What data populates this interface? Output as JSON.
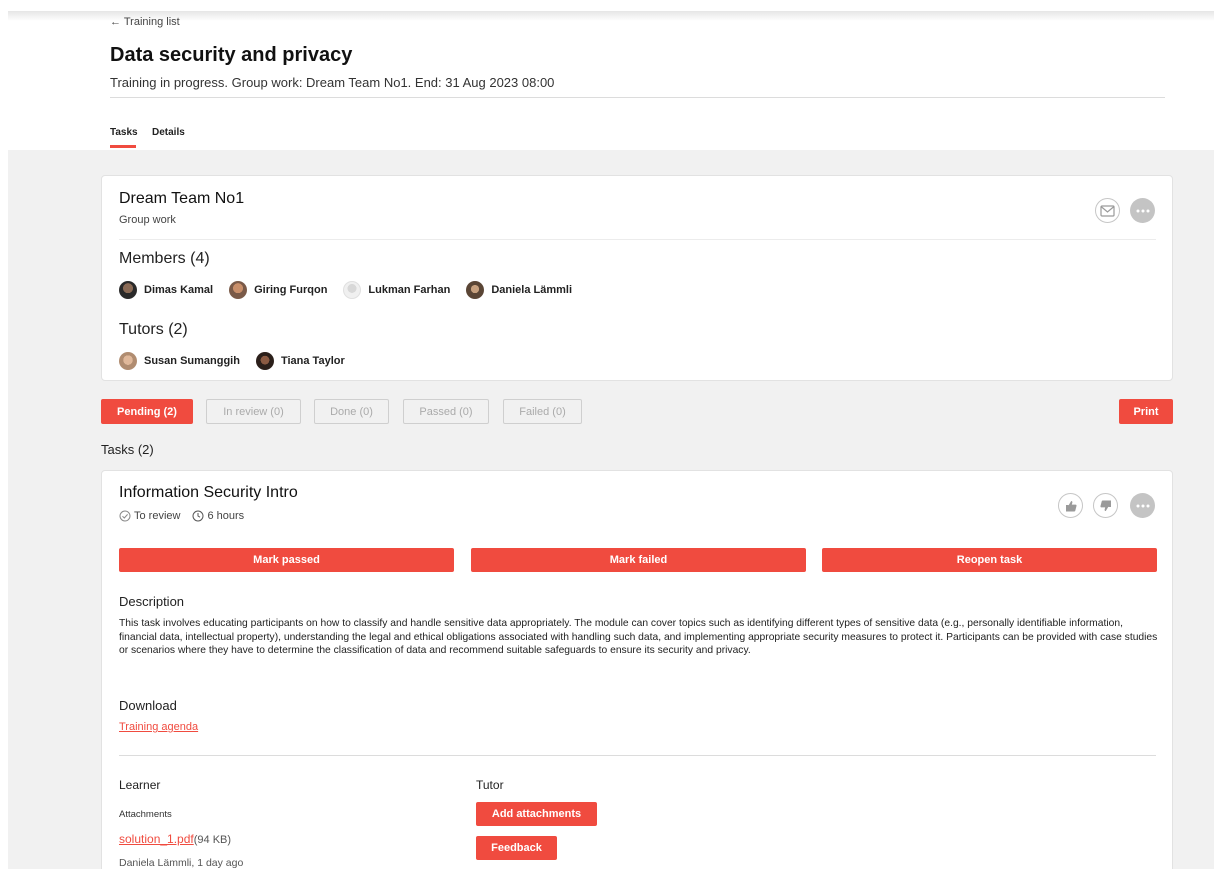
{
  "header": {
    "back_label": "← Training list",
    "title": "Data security and privacy",
    "subtitle": "Training in progress. Group work: Dream Team No1. End: 31 Aug 2023 08:00",
    "tabs": [
      {
        "label": "Tasks",
        "active": true
      },
      {
        "label": "Details",
        "active": false
      }
    ]
  },
  "team": {
    "name": "Dream Team No1",
    "kind": "Group work",
    "members_heading": "Members (4)",
    "members": [
      {
        "name": "Dimas Kamal"
      },
      {
        "name": "Giring Furqon"
      },
      {
        "name": "Lukman Farhan"
      },
      {
        "name": "Daniela Lämmli"
      }
    ],
    "tutors_heading": "Tutors (2)",
    "tutors": [
      {
        "name": "Susan Sumanggih"
      },
      {
        "name": "Tiana Taylor"
      }
    ],
    "icons": [
      "mail-icon",
      "more-icon"
    ]
  },
  "filters": [
    {
      "label": "Pending (2)",
      "active": true
    },
    {
      "label": "In review (0)",
      "active": false
    },
    {
      "label": "Done (0)",
      "active": false
    },
    {
      "label": "Passed (0)",
      "active": false
    },
    {
      "label": "Failed (0)",
      "active": false
    }
  ],
  "print_label": "Print",
  "tasks_heading": "Tasks (2)",
  "task": {
    "title": "Information Security Intro",
    "status": "To review",
    "duration": "6 hours",
    "icons": [
      "thumbs-up-icon",
      "thumbs-down-icon",
      "more-icon"
    ],
    "actions": [
      "Mark passed",
      "Mark failed",
      "Reopen task"
    ],
    "description_heading": "Description",
    "description": "This task involves educating participants on how to classify and handle sensitive data appropriately. The module can cover topics such as identifying different types of sensitive data (e.g., personally identifiable information, financial data, intellectual property), understanding the legal and ethical obligations associated with handling such data, and implementing appropriate security measures to protect it. Participants can be provided with case studies or scenarios where they have to determine the classification of data and recommend suitable safeguards to ensure its security and privacy.",
    "download_heading": "Download",
    "download_link": "Training agenda",
    "learner_heading": "Learner",
    "attachments_label": "Attachments",
    "file_name": "solution_1.pdf",
    "file_size": "(94 KB)",
    "file_meta": "Daniela Lämmli, 1 day ago",
    "tutor_heading": "Tutor",
    "add_attachments_label": "Add attachments",
    "feedback_label": "Feedback"
  },
  "colors": {
    "accent": "#f04b3f",
    "background": "#f1f1f1"
  }
}
